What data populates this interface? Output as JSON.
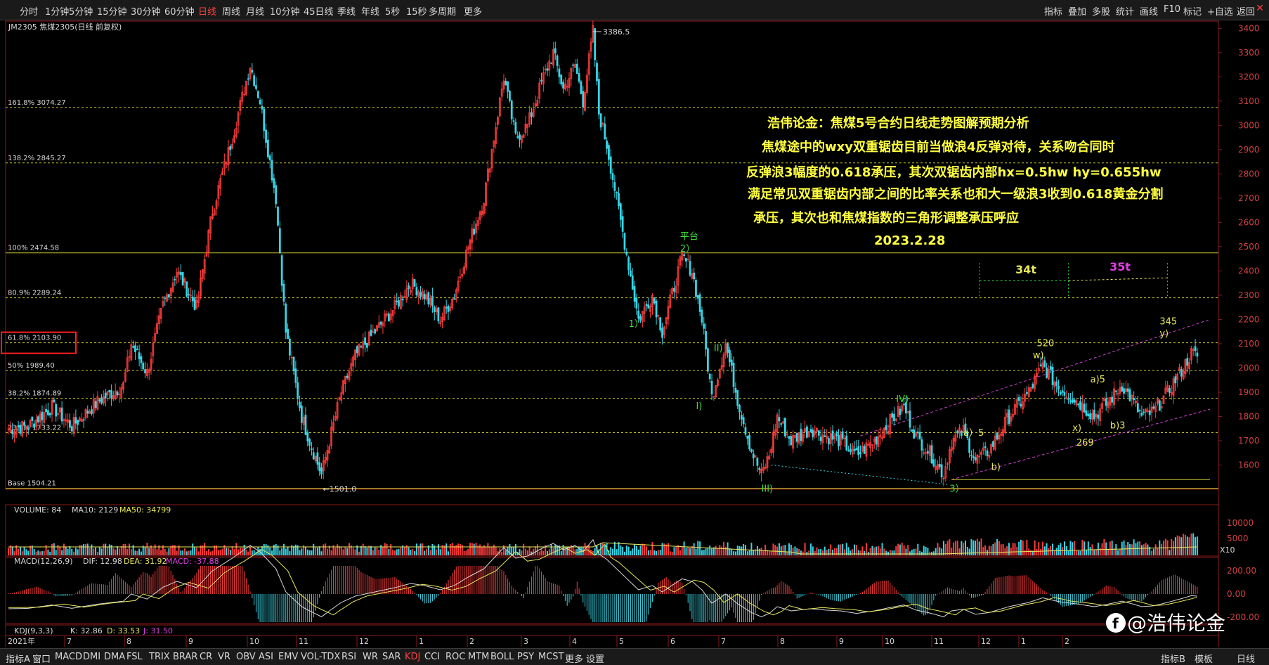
{
  "toolbar": {
    "left": [
      "分时",
      "1分钟",
      "5分钟",
      "15分钟",
      "30分钟",
      "60分钟",
      "日线",
      "周线",
      "月线",
      "10分钟",
      "45日线",
      "季线",
      "年线",
      "5秒",
      "15秒",
      "多周期",
      "更多"
    ],
    "active": "日线",
    "right": [
      "指标",
      "叠加",
      "多股",
      "统计",
      "画线",
      "F10",
      "标记",
      "+自选",
      "返回"
    ]
  },
  "bottom_tabs": {
    "items": [
      "指标A",
      "窗口",
      "MACD",
      "DMI",
      "DMA",
      "FSL",
      "TRIX",
      "BRAR",
      "CR",
      "VR",
      "OBV",
      "ASI",
      "EMV",
      "VOL-TDX",
      "RSI",
      "WR",
      "SAR",
      "KDJ",
      "CCI",
      "ROC",
      "MTM",
      "BOLL",
      "PSY",
      "MCST",
      "更多",
      "设置"
    ],
    "active": "KDJ",
    "right": [
      "指标B",
      "模板",
      "日线"
    ]
  },
  "chart_header": "JM2305 焦煤2305(日线 前复权)",
  "annotation": {
    "line1": "浩伟论金：焦煤5号合约日线走势图解预期分析",
    "line2": "焦煤途中的wxy双重锯齿目前当做浪4反弹对待，关系吻合同时",
    "line3": "反弹浪3幅度的0.618承压，其次双锯齿内部hx=0.5hw  hy=0.655hw",
    "line4": "满足常见双重锯齿内部之间的比率关系也和大一级浪3收到0.618黄金分割",
    "line5": "承压，其次也和焦煤指数的三角形调整承压呼应",
    "date": "2023.2.28"
  },
  "watermark": "@浩伟论金",
  "panels": {
    "volume_header": {
      "label": "VOLUME: 84",
      "ma10": "MA10: 2129",
      "ma50": "MA50: 34799"
    },
    "macd_header": {
      "label": "MACD(12,26,9)",
      "dif": "DIF: 12.98",
      "dea": "DEA: 31.92",
      "macd": "MACD: -37.88"
    },
    "kdj_header": {
      "label": "KDJ(9,3,3)",
      "k": "K: 32.86",
      "d": "D: 33.53",
      "j": "J: 31.50"
    },
    "volume_ticks": [
      "10000",
      "5000",
      "X10"
    ],
    "macd_ticks": [
      "200.00",
      "0.00",
      "-200.00"
    ]
  },
  "chart_data": {
    "type": "candlestick",
    "symbol": "JM2305",
    "name": "焦煤2305",
    "y_ticks": [
      1600,
      1700,
      1800,
      1900,
      2000,
      2100,
      2200,
      2300,
      2400,
      2500,
      2600,
      2700,
      2800,
      2900,
      3000,
      3100,
      3200,
      3300,
      3400
    ],
    "ylim": [
      1500,
      3430
    ],
    "x_labels": [
      "2021年",
      "7",
      "8",
      "9",
      "10",
      "11",
      "12",
      "1",
      "2",
      "3",
      "4",
      "5",
      "6",
      "7",
      "8",
      "9",
      "10",
      "11",
      "12",
      "1",
      "2"
    ],
    "price_path": [
      [
        0,
        1750
      ],
      [
        10,
        1760
      ],
      [
        22,
        1840
      ],
      [
        32,
        1760
      ],
      [
        45,
        1860
      ],
      [
        58,
        1930
      ],
      [
        62,
        2100
      ],
      [
        70,
        1980
      ],
      [
        78,
        2260
      ],
      [
        85,
        2400
      ],
      [
        95,
        2250
      ],
      [
        103,
        2650
      ],
      [
        113,
        2950
      ],
      [
        122,
        3250
      ],
      [
        127,
        3100
      ],
      [
        130,
        2950
      ],
      [
        135,
        2700
      ],
      [
        140,
        2150
      ],
      [
        148,
        1800
      ],
      [
        152,
        1700
      ],
      [
        158,
        1560
      ],
      [
        162,
        1700
      ],
      [
        168,
        1900
      ],
      [
        175,
        2050
      ],
      [
        185,
        2150
      ],
      [
        195,
        2250
      ],
      [
        203,
        2350
      ],
      [
        210,
        2300
      ],
      [
        218,
        2200
      ],
      [
        225,
        2300
      ],
      [
        232,
        2500
      ],
      [
        240,
        2700
      ],
      [
        245,
        2950
      ],
      [
        250,
        3200
      ],
      [
        256,
        2950
      ],
      [
        262,
        3000
      ],
      [
        270,
        3200
      ],
      [
        275,
        3300
      ],
      [
        280,
        3150
      ],
      [
        286,
        3250
      ],
      [
        290,
        3100
      ],
      [
        295,
        3386
      ],
      [
        298,
        3050
      ],
      [
        302,
        2920
      ],
      [
        318,
        2200
      ],
      [
        325,
        2300
      ],
      [
        330,
        2150
      ],
      [
        340,
        2460
      ],
      [
        345,
        2400
      ],
      [
        350,
        2200
      ],
      [
        355,
        1880
      ],
      [
        362,
        2100
      ],
      [
        368,
        1870
      ],
      [
        375,
        1660
      ],
      [
        380,
        1560
      ],
      [
        384,
        1640
      ],
      [
        388,
        1800
      ],
      [
        395,
        1700
      ],
      [
        405,
        1750
      ],
      [
        412,
        1720
      ],
      [
        420,
        1700
      ],
      [
        428,
        1640
      ],
      [
        437,
        1700
      ],
      [
        445,
        1780
      ],
      [
        452,
        1840
      ],
      [
        458,
        1720
      ],
      [
        465,
        1650
      ],
      [
        472,
        1560
      ],
      [
        476,
        1700
      ],
      [
        482,
        1740
      ],
      [
        488,
        1620
      ],
      [
        495,
        1660
      ],
      [
        505,
        1800
      ],
      [
        515,
        1900
      ],
      [
        522,
        2010
      ],
      [
        530,
        1920
      ],
      [
        540,
        1860
      ],
      [
        548,
        1800
      ],
      [
        555,
        1860
      ],
      [
        562,
        1930
      ],
      [
        567,
        1870
      ],
      [
        572,
        1800
      ],
      [
        578,
        1820
      ],
      [
        585,
        1900
      ],
      [
        592,
        1990
      ],
      [
        597,
        2060
      ],
      [
        600,
        2050
      ]
    ],
    "levels": [
      {
        "label": "161.8% 3074.27",
        "value": 3074.27
      },
      {
        "label": "138.2% 2845.27",
        "value": 2845.27
      },
      {
        "label": "100% 2474.58",
        "value": 2474.58
      },
      {
        "label": "80.9% 2289.24",
        "value": 2289.24
      },
      {
        "label": "61.8% 2103.90",
        "value": 2103.9
      },
      {
        "label": "50% 1989.40",
        "value": 1989.4
      },
      {
        "label": "38.2% 1874.89",
        "value": 1874.89
      },
      {
        "label": "23.6% 1733.22",
        "value": 1733.22
      },
      {
        "label": "Base 1504.21",
        "value": 1504.21
      }
    ],
    "price_labels": {
      "high": "3386.5",
      "low": "1501.0"
    },
    "wave_labels": [
      {
        "t": "平台",
        "x": 339,
        "y": 2530,
        "c": "#3ddc3d"
      },
      {
        "t": "2）",
        "x": 339,
        "y": 2480,
        "c": "#3ddc3d"
      },
      {
        "t": "1）",
        "x": 313,
        "y": 2170,
        "c": "#3ddc3d"
      },
      {
        "t": "II)",
        "x": 356,
        "y": 2070,
        "c": "#3ddc3d"
      },
      {
        "t": "I)",
        "x": 347,
        "y": 1830,
        "c": "#3ddc3d"
      },
      {
        "t": "III)",
        "x": 380,
        "y": 1490,
        "c": "#3ddc3d"
      },
      {
        "t": "IV)",
        "x": 448,
        "y": 1860,
        "c": "#3ddc3d"
      },
      {
        "t": "3）",
        "x": 475,
        "y": 1490,
        "c": "#3ddc3d"
      },
      {
        "t": "a）5",
        "x": 482,
        "y": 1720,
        "c": "#e8e85a"
      },
      {
        "t": "b)",
        "x": 496,
        "y": 1580,
        "c": "#e8e85a"
      },
      {
        "t": "520",
        "x": 519,
        "y": 2090,
        "c": "#e8e85a"
      },
      {
        "t": "w)",
        "x": 517,
        "y": 2040,
        "c": "#e8e85a"
      },
      {
        "t": "x)",
        "x": 537,
        "y": 1740,
        "c": "#e8e85a"
      },
      {
        "t": "269",
        "x": 539,
        "y": 1680,
        "c": "#e8e85a"
      },
      {
        "t": "a)5",
        "x": 546,
        "y": 1940,
        "c": "#e8e85a"
      },
      {
        "t": "b)3",
        "x": 556,
        "y": 1750,
        "c": "#e8e85a"
      },
      {
        "t": "345",
        "x": 581,
        "y": 2180,
        "c": "#e8e85a"
      },
      {
        "t": "y)",
        "x": 581,
        "y": 2130,
        "c": "#e8e85a"
      }
    ],
    "time_counts": [
      {
        "label": "34t",
        "color": "#e8e85a"
      },
      {
        "label": "35t",
        "color": "#e040e0"
      }
    ]
  }
}
